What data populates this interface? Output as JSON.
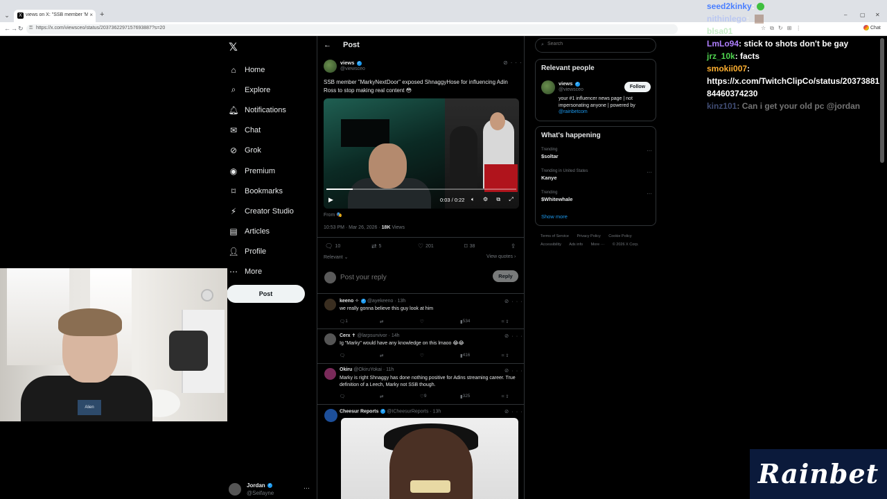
{
  "browser": {
    "tab_title": "views on X: \"SSB member 'MarkyN...",
    "url": "https://x.com/viewsceo/status/2037362297157693887?s=20",
    "tab_favicon": "X",
    "new_tab": "+",
    "tab_close": "×",
    "win_min": "–",
    "win_max": "▢",
    "win_close": "✕",
    "chat_label": "Chat"
  },
  "nav": {
    "logo": "𝕏",
    "items": [
      {
        "label": "Home",
        "icon": "home-icon",
        "glyph": "⌂"
      },
      {
        "label": "Explore",
        "icon": "search-icon",
        "glyph": "⌕"
      },
      {
        "label": "Notifications",
        "icon": "bell-icon",
        "glyph": "🔔︎"
      },
      {
        "label": "Chat",
        "icon": "mail-icon",
        "glyph": "✉"
      },
      {
        "label": "Grok",
        "icon": "grok-icon",
        "glyph": "⊘"
      },
      {
        "label": "Premium",
        "icon": "premium-icon",
        "glyph": "◉"
      },
      {
        "label": "Bookmarks",
        "icon": "bookmark-icon",
        "glyph": "⌑"
      },
      {
        "label": "Creator Studio",
        "icon": "lightning-icon",
        "glyph": "⚡︎"
      },
      {
        "label": "Articles",
        "icon": "article-icon",
        "glyph": "▤"
      },
      {
        "label": "Profile",
        "icon": "person-icon",
        "glyph": "👤︎"
      },
      {
        "label": "More",
        "icon": "more-icon",
        "glyph": "⋯"
      }
    ],
    "post_button": "Post",
    "account": {
      "name": "Jordan",
      "handle": "@Seifayne",
      "more": "···"
    }
  },
  "main": {
    "header_title": "Post",
    "back": "←",
    "post": {
      "author": "views",
      "handle": "@viewsceo",
      "text": "SSB member \"MarkyNextDoor\" exposed ShnaggyHose for influencing Adin Ross to stop making real content 😳",
      "video": {
        "time": "0:03 / 0:22",
        "progress": 0.14,
        "play": "▶",
        "controls": "🔈︎ ⚙ ⧉ ⤢"
      },
      "from": "From 🎭",
      "timestamp": "10:53 PM · Mar 26, 2026 · ",
      "views": "18K",
      "views_label": " Views",
      "stats": {
        "replies": "10",
        "reposts": "5",
        "likes": "201",
        "bookmarks": "38"
      },
      "relevant": "Relevant ⌄",
      "view_quotes": "View quotes ›"
    },
    "reply_box": {
      "placeholder": "Post your reply",
      "button": "Reply"
    },
    "replies": [
      {
        "name": "keeno ✧",
        "handle": "@ayekeeno · 13h",
        "text": "we really gonna believe this guy look at him",
        "stats": {
          "replies": "1",
          "views": "534"
        }
      },
      {
        "name": "Cerx ✝",
        "handle": "@larpsurvivor · 14h",
        "text": "Ig \"Marky\" would have any knowledge on this lmaoo 😂😂",
        "stats": {
          "replies": "",
          "views": "416"
        }
      },
      {
        "name": "Okiru",
        "handle": "@OkiruYokai · 11h",
        "text": "Marky is right Shnaggy has done nothing positive for Adins streaming career. True definition of a Leech, Marky not SSB though.",
        "stats": {
          "replies": "",
          "likes": "9",
          "views": "325"
        }
      },
      {
        "name": "Cheesur Reports",
        "handle": "@ICheesurReports · 13h",
        "text": ""
      }
    ]
  },
  "sidebar": {
    "search_placeholder": "Search",
    "relevant_people": {
      "title": "Relevant people",
      "name": "views",
      "handle": "@viewsceo",
      "follow": "Follow",
      "bio": "your #1 influencer news page | not impersonating anyone | powered by ",
      "bio_link": "@rainbetcom"
    },
    "happening": {
      "title": "What's happening",
      "trends": [
        {
          "context": "Trending",
          "name": "$soltar"
        },
        {
          "context": "Trending in United States",
          "name": "Kanye"
        },
        {
          "context": "Trending",
          "name": "$Whitewhale"
        }
      ],
      "show_more": "Show more"
    },
    "footer": [
      "Terms of Service",
      "Privacy Policy",
      "Cookie Policy",
      "Accessibility",
      "Ads info",
      "More ···",
      "© 2026 X Corp."
    ]
  },
  "chat": {
    "lines": [
      {
        "user": "seed2kinky",
        "color": "#4a7fff",
        "msg": ""
      },
      {
        "user": "nithinlego",
        "color": "#8fa8ff",
        "msg": ""
      },
      {
        "user": "blsa01",
        "color": "#7fd47f",
        "msg": ""
      },
      {
        "user": "LmLo94",
        "color": "#b07fff",
        "msg": "stick to shots don't be gay"
      },
      {
        "user": "jrz_10k",
        "color": "#4fd44f",
        "msg": "facts"
      },
      {
        "user": "smokii007",
        "color": "#ffb030",
        "msg": ""
      },
      {
        "user": "",
        "color": "#ffffff",
        "msg": "https://x.com/TwitchClipCo/status/20373881"
      },
      {
        "user": "",
        "color": "#ffffff",
        "msg": "84460374230"
      },
      {
        "user": "kinz101",
        "color": "#8fa8ff",
        "msg": "Can i get your old pc @jordan"
      }
    ]
  },
  "overlay": {
    "brand": "Rainbet"
  },
  "webcam": {
    "shirt_logo": "Alien"
  }
}
